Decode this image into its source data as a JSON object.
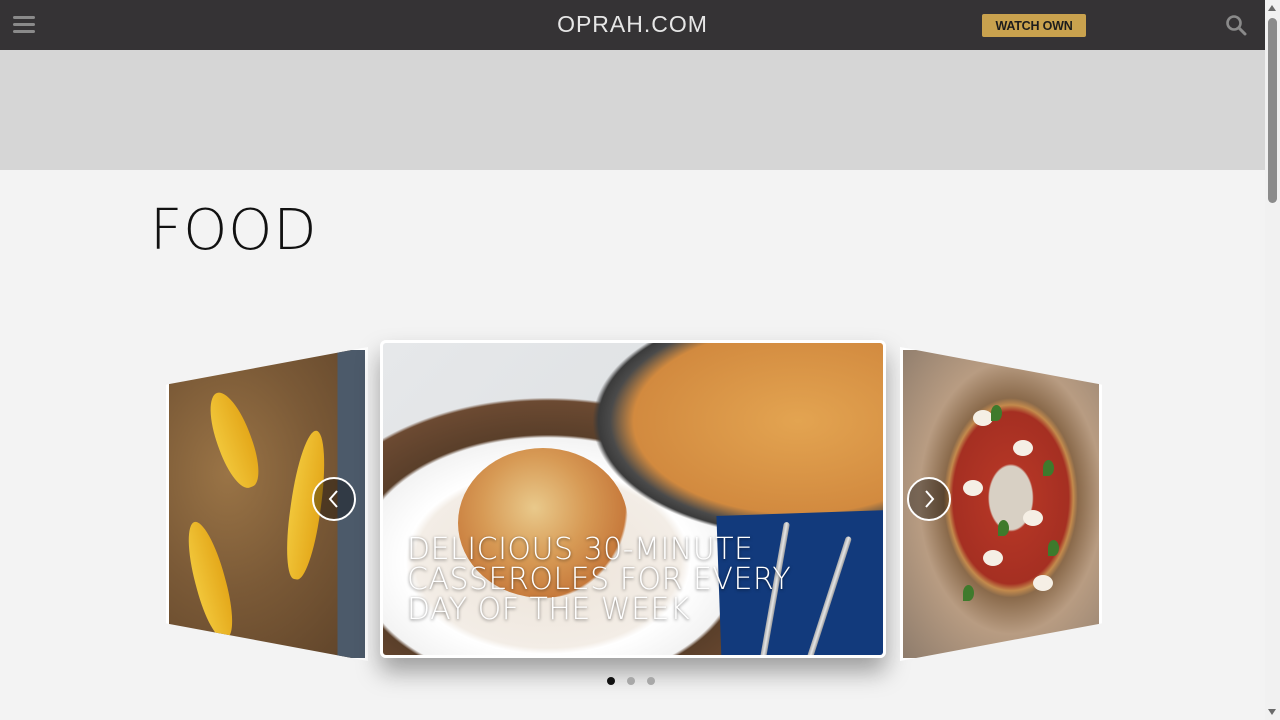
{
  "header": {
    "brand": "OPRAH.COM",
    "watch_label": "WATCH OWN",
    "menu_icon": "hamburger-menu-icon",
    "search_icon": "search-icon"
  },
  "page": {
    "title": "FOOD"
  },
  "carousel": {
    "slides": [
      {
        "name": "lemons-on-cutting-board"
      },
      {
        "name": "casserole",
        "caption": "DELICIOUS 30-MINUTE CASSEROLES FOR EVERY DAY OF THE WEEK"
      },
      {
        "name": "margherita-pizza"
      }
    ],
    "prev_icon": "chevron-left-icon",
    "next_icon": "chevron-right-icon",
    "active_index": 2,
    "dot_count": 3,
    "active_dot": 1
  },
  "colors": {
    "header_bg": "#353335",
    "watch_button": "#c9a24e",
    "ad_bg": "#d6d6d6",
    "page_bg": "#f3f3f3"
  }
}
